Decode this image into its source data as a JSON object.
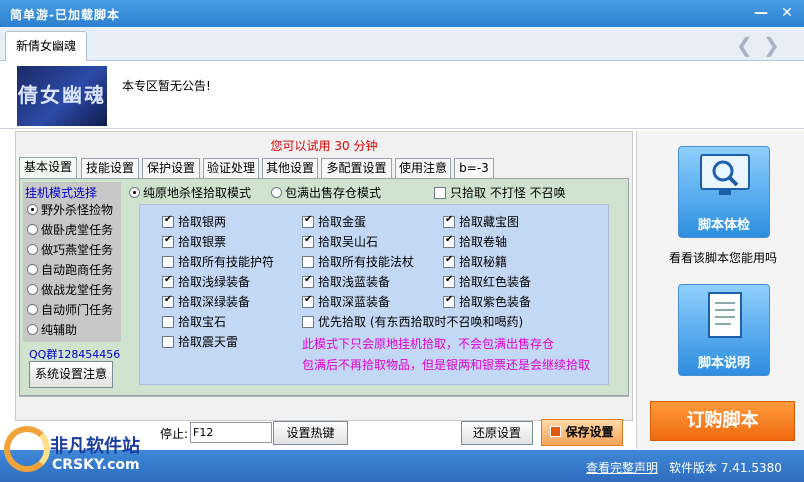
{
  "window": {
    "title": "简单游-已加载脚本",
    "minimize_glyph": "—",
    "close_glyph": "✕"
  },
  "game_tab": {
    "label": "新倩女幽魂",
    "prev_icon": "chevron-left-icon",
    "next_icon": "chevron-right-icon"
  },
  "announcement": {
    "logo_text": "倩女幽魂",
    "text": "本专区暂无公告!"
  },
  "trial_notice": "您可以试用 30 分钟",
  "tabs": [
    "基本设置",
    "技能设置",
    "保护设置",
    "验证处理",
    "其他设置",
    "多配置设置",
    "使用注意",
    "b=-3"
  ],
  "left_panel": {
    "title": "挂机模式选择",
    "modes": [
      {
        "label": "野外杀怪捡物",
        "selected": true
      },
      {
        "label": "做卧虎堂任务",
        "selected": false
      },
      {
        "label": "做巧燕堂任务",
        "selected": false
      },
      {
        "label": "自动跑商任务",
        "selected": false
      },
      {
        "label": "做战龙堂任务",
        "selected": false
      },
      {
        "label": "自动师门任务",
        "selected": false
      },
      {
        "label": "纯辅助",
        "selected": false
      }
    ],
    "qq": "QQ群128454456",
    "system_button": "系统设置注意"
  },
  "pickup_mode": {
    "option1": {
      "label": "纯原地杀怪拾取模式",
      "selected": true
    },
    "option2": {
      "label": "包满出售存仓模式",
      "selected": false
    },
    "pickup_only": {
      "label": "只拾取 不打怪 不召唤",
      "checked": false
    }
  },
  "pickup_items": [
    {
      "label": "拾取银两",
      "checked": true
    },
    {
      "label": "拾取金蛋",
      "checked": true
    },
    {
      "label": "拾取藏宝图",
      "checked": true
    },
    {
      "label": "拾取银票",
      "checked": true
    },
    {
      "label": "拾取吴山石",
      "checked": true
    },
    {
      "label": "拾取卷轴",
      "checked": true
    },
    {
      "label": "拾取所有技能护符",
      "checked": false
    },
    {
      "label": "拾取所有技能法杖",
      "checked": false
    },
    {
      "label": "拾取秘籍",
      "checked": true
    },
    {
      "label": "拾取浅绿装备",
      "checked": true
    },
    {
      "label": "拾取浅蓝装备",
      "checked": true
    },
    {
      "label": "拾取红色装备",
      "checked": true
    },
    {
      "label": "拾取深绿装备",
      "checked": true
    },
    {
      "label": "拾取深蓝装备",
      "checked": true
    },
    {
      "label": "拾取紫色装备",
      "checked": true
    },
    {
      "label": "拾取宝石",
      "checked": false
    },
    {
      "label": "优先拾取 (有东西拾取时不召唤和喝药)",
      "checked": false
    },
    {
      "label": "拾取震天雷",
      "checked": false
    }
  ],
  "notes": {
    "line1": "此模式下只会原地挂机拾取，不会包满出售存仓",
    "line2": "包满后不再拾取物品，但是银两和银票还是会继续拾取"
  },
  "hotkey": {
    "label": "停止:",
    "value": "F12",
    "set_button": "设置热键"
  },
  "buttons": {
    "restore": "还原设置",
    "save": "保存设置"
  },
  "right_panel": {
    "check_button": "脚本体检",
    "check_caption": "看看该脚本您能用吗",
    "info_button": "脚本说明",
    "order_button": "订购脚本"
  },
  "site_logo": {
    "cn": "非凡软件站",
    "en": "CRSKY.com"
  },
  "status": {
    "disclaimer_link": "查看完整声明",
    "version": "软件版本 7.41.5380"
  }
}
